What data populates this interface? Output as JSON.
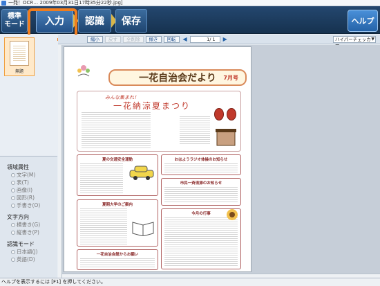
{
  "window": {
    "title": "一発！OCR… 2009年03月31日17時35分22秒.jpg]"
  },
  "toolbar": {
    "mode_label": "標準\nモード",
    "steps": [
      {
        "label": "入力"
      },
      {
        "label": "認識"
      },
      {
        "label": "保存"
      }
    ],
    "help_label": "ヘルプ"
  },
  "subbar": {
    "buttons": [
      {
        "label": "縮小",
        "enabled": true
      },
      {
        "label": "戻す",
        "enabled": false
      },
      {
        "label": "全削除",
        "enabled": false
      },
      {
        "label": "傾き",
        "enabled": true
      },
      {
        "label": "回転",
        "enabled": true
      }
    ],
    "page_indicator": "1/ 1",
    "checker_select": "ハイパーチェッカー"
  },
  "thumbnails": [
    {
      "label": "無題"
    }
  ],
  "properties": {
    "region_title": "領域属性",
    "region_options": [
      "文字(M)",
      "表(T)",
      "画像(I)",
      "図形(R)",
      "手書き(O)"
    ],
    "direction_title": "文字方向",
    "direction_options": [
      "横書き(G)",
      "縦書き(P)"
    ],
    "recog_title": "認識モード",
    "recog_options": [
      "日本語(J)",
      "英語(D)"
    ]
  },
  "document": {
    "title": "一花自治会だより",
    "month": "7月号",
    "festival_sub": "みんな集まれ！",
    "festival_title": "一花納涼夏まつり",
    "boxes": [
      "夏の交通安全運動",
      "おはようラジオ体操のお知らせ",
      "市民一斉清掃のお知らせ",
      "夏期大学のご案内",
      "今月の行事",
      "一花自治会館からお願い"
    ]
  },
  "status": {
    "text": "ヘルプを表示するには [F1] を押してください。"
  },
  "colors": {
    "highlight": "#f07d1e",
    "toolbar": "#1f3f63",
    "help": "#2f77c4"
  }
}
